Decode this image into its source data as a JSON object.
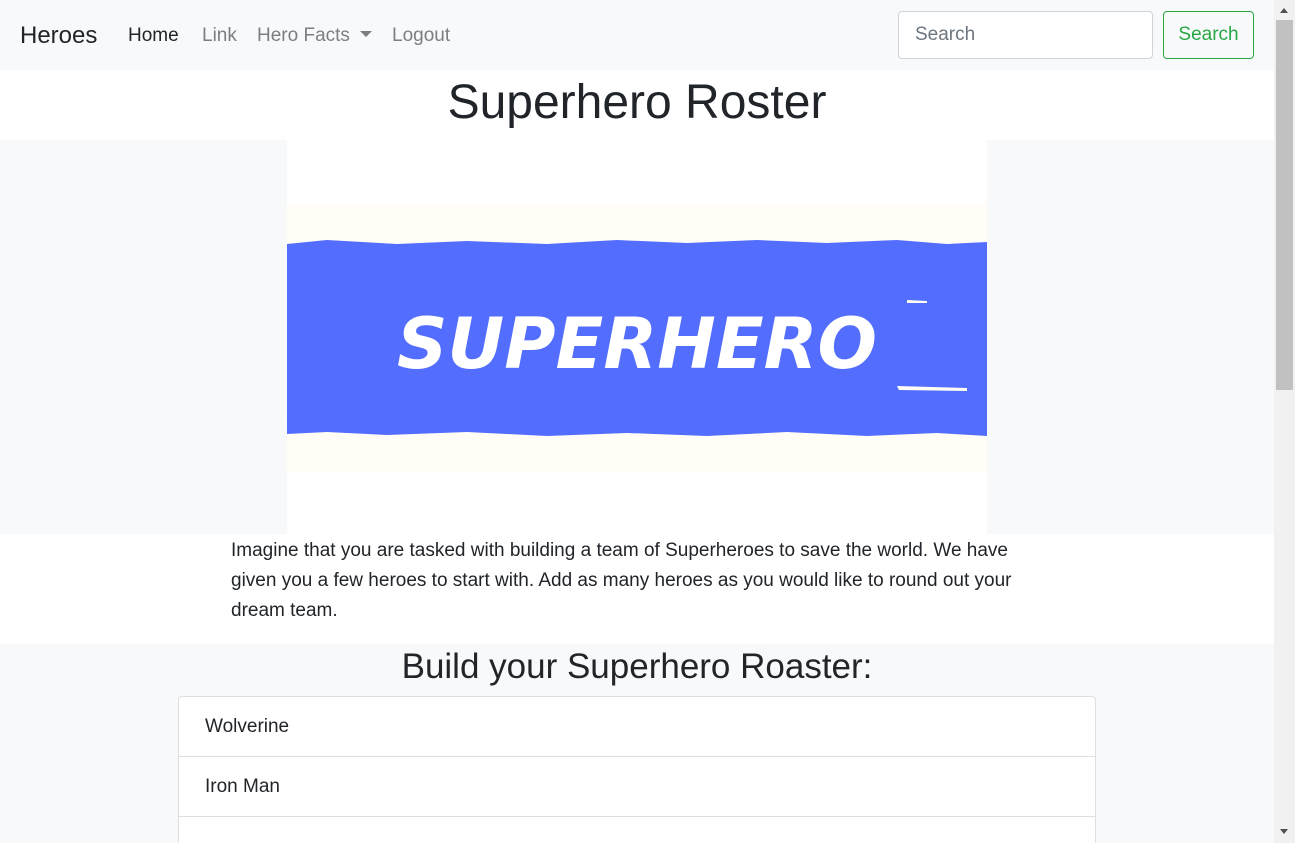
{
  "navbar": {
    "brand": "Heroes",
    "links": [
      {
        "label": "Home"
      },
      {
        "label": "Link"
      },
      {
        "label": "Hero Facts"
      },
      {
        "label": "Logout"
      }
    ],
    "search_placeholder": "Search",
    "search_button": "Search"
  },
  "main": {
    "title": "Superhero Roster",
    "banner_text": "SUPERHERO",
    "intro": "Imagine that you are tasked with building a team of Superheroes to save the world. We have given you a few heroes to start with. Add as many heroes as you would like to round out your dream team.",
    "roster_title": "Build your Superhero Roaster:",
    "heroes": [
      "Wolverine",
      "Iron Man"
    ]
  },
  "colors": {
    "banner_blue": "#536dfe",
    "banner_cream": "#fffdf5",
    "search_green": "#28a745",
    "navbar_bg": "#f8f9fa"
  }
}
